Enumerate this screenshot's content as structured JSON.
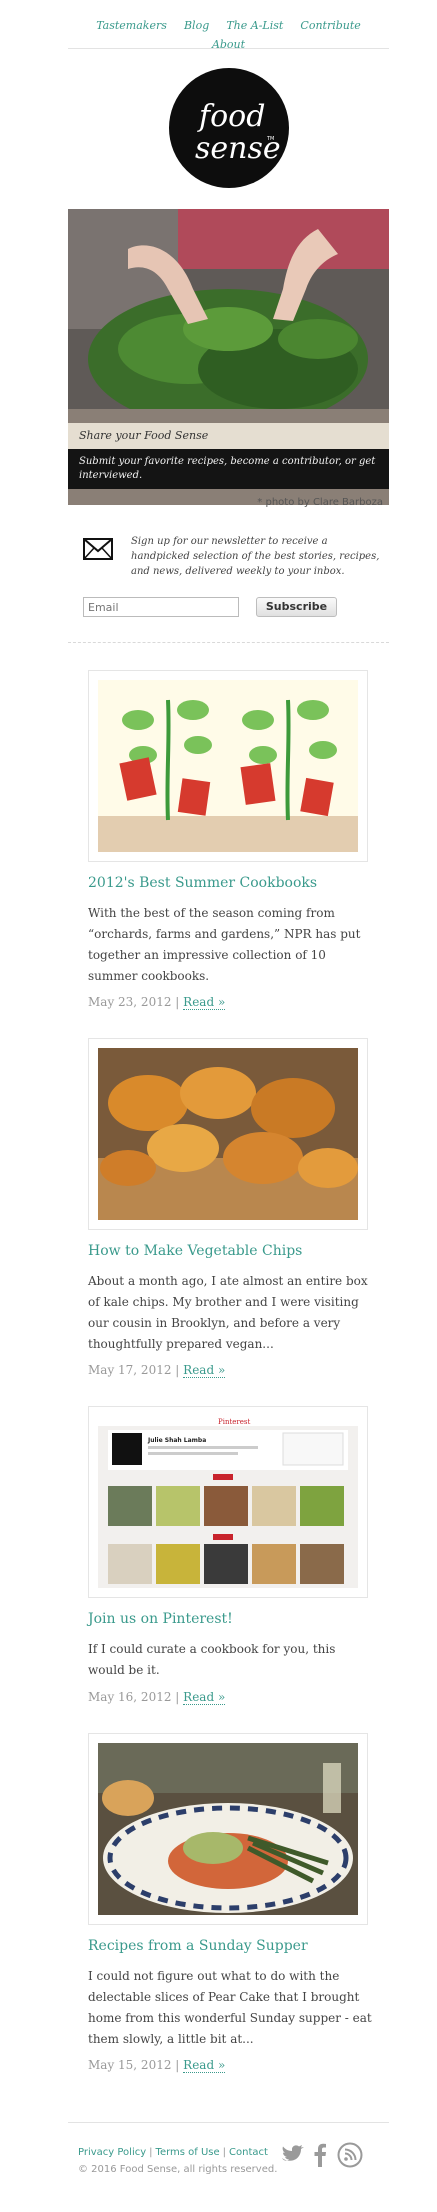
{
  "nav": {
    "items": [
      {
        "label": "Tastemakers"
      },
      {
        "label": "Blog"
      },
      {
        "label": "The A-List"
      },
      {
        "label": "Contribute"
      },
      {
        "label": "About"
      }
    ]
  },
  "logo": {
    "alt": "food sense"
  },
  "hero": {
    "caption": "Share your Food Sense",
    "tagline": "Submit your favorite recipes, become a contributor, or get interviewed.",
    "credit": "* photo by Clare Barboza"
  },
  "newsletter": {
    "text": "Sign up for our newsletter to receive a handpicked selection of the best stories, recipes, and news, delivered weekly to your inbox.",
    "placeholder": "Email",
    "button": "Subscribe"
  },
  "posts": [
    {
      "title": "2012's Best Summer Cookbooks",
      "excerpt": "With the best of the season coming from “orchards, farms and gardens,” NPR has put together an impressive collection of 10 summer cookbooks.",
      "date": "May 23, 2012 |",
      "read": "Read »"
    },
    {
      "title": "How to Make Vegetable Chips",
      "excerpt": "About a month ago, I ate almost an entire box of kale chips. My brother and I were visiting our cousin in Brooklyn, and before a very thoughtfully prepared vegan...",
      "date": "May 17, 2012 |",
      "read": "Read »"
    },
    {
      "title": "Join us on Pinterest!",
      "excerpt": "If I could curate a cookbook for you, this would be it.",
      "date": "May 16, 2012 |",
      "read": "Read »",
      "image": {
        "brand": "Pinterest",
        "profile": "Julie Shah Lamba"
      }
    },
    {
      "title": "Recipes from a Sunday Supper",
      "excerpt": "I could not figure out what to do with the delectable slices of Pear Cake that I brought home from this wonderful Sunday supper - eat them slowly, a little bit at...",
      "date": "May 15, 2012 |",
      "read": "Read »"
    }
  ],
  "footer": {
    "privacy": "Privacy Policy",
    "terms": "Terms of Use",
    "contact": "Contact",
    "copyright": "© 2016 Food Sense, all rights reserved."
  },
  "colors": {
    "accent": "#3a9a8c",
    "text": "#444444",
    "muted": "#999999"
  },
  "icons": {
    "newsletter": "envelope-icon",
    "social": [
      "twitter-icon",
      "facebook-icon",
      "rss-icon"
    ]
  }
}
